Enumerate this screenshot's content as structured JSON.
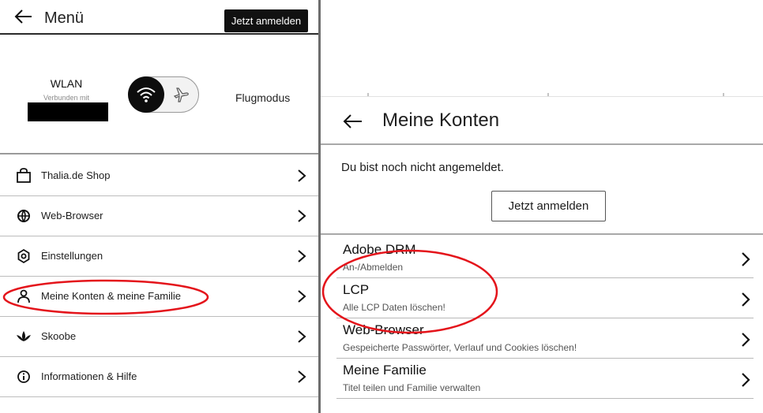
{
  "left_panel": {
    "header": {
      "title": "Menü",
      "login_button": "Jetzt anmelden"
    },
    "connectivity": {
      "wlan_label": "WLAN",
      "wlan_status": "Verbunden mit",
      "airplane_label": "Flugmodus"
    },
    "menu_items": [
      {
        "label": "Thalia.de Shop",
        "icon": "shopping-bag-icon"
      },
      {
        "label": "Web-Browser",
        "icon": "globe-icon"
      },
      {
        "label": "Einstellungen",
        "icon": "gear-icon"
      },
      {
        "label": "Meine Konten & meine Familie",
        "icon": "person-icon"
      },
      {
        "label": "Skoobe",
        "icon": "skoobe-logo-icon"
      },
      {
        "label": "Informationen & Hilfe",
        "icon": "info-icon"
      }
    ]
  },
  "right_panel": {
    "header": {
      "title": "Meine Konten"
    },
    "notice": "Du bist noch nicht angemeldet.",
    "login_button": "Jetzt anmelden",
    "accounts": [
      {
        "title": "Adobe DRM",
        "subtitle": "An-/Abmelden"
      },
      {
        "title": "LCP",
        "subtitle": "Alle LCP Daten löschen!"
      },
      {
        "title": "Web-Browser",
        "subtitle": "Gespeicherte Passwörter, Verlauf und Cookies löschen!"
      },
      {
        "title": "Meine Familie",
        "subtitle": "Titel teilen und Familie verwalten"
      }
    ]
  },
  "annotations": {
    "highlight_color": "#e4141b"
  }
}
